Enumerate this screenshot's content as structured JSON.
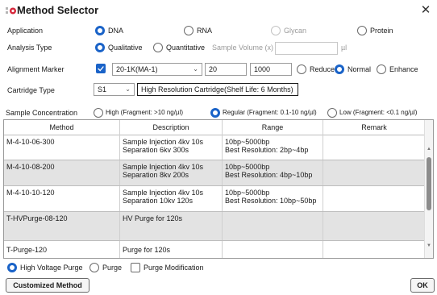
{
  "window": {
    "title": "Method Selector",
    "close_symbol": "✕"
  },
  "application": {
    "label": "Application",
    "options": [
      "DNA",
      "RNA",
      "Glycan",
      "Protein"
    ],
    "selected": "DNA"
  },
  "analysis": {
    "label": "Analysis Type",
    "options": [
      "Qualitative",
      "Quantitative"
    ],
    "selected": "Qualitative",
    "volume_label": "Sample Volume (x) :",
    "volume_value": "",
    "volume_unit": "µl"
  },
  "alignment": {
    "label": "Alignment Marker",
    "checked": true,
    "marker_value": "20-1K(MA-1)",
    "low_value": "20",
    "high_value": "1000",
    "modes": [
      "Reduce",
      "Normal",
      "Enhance"
    ],
    "selected_mode": "Normal"
  },
  "cartridge": {
    "label": "Cartridge Type",
    "type_value": "S1",
    "description": "High Resolution Cartridge(Shelf Life: 6 Months)"
  },
  "concentration": {
    "label": "Sample Concentration",
    "options": [
      "High (Fragment: >10 ng/µl)",
      "Regular (Fragment: 0.1-10 ng/µl)",
      "Low (Fragment: <0.1 ng/µl)"
    ],
    "selected": "Regular (Fragment: 0.1-10 ng/µl)"
  },
  "table": {
    "columns": [
      "Method",
      "Description",
      "Range",
      "Remark"
    ],
    "rows": [
      {
        "method": "M-4-10-06-300",
        "desc1": "Sample Injection 4kv 10s",
        "desc2": "Separation 6kv 300s",
        "range1": "10bp~5000bp",
        "range2": "Best Resolution: 2bp~4bp",
        "remark": ""
      },
      {
        "method": "M-4-10-08-200",
        "desc1": "Sample Injection 4kv 10s",
        "desc2": "Separation 8kv 200s",
        "range1": "10bp~5000bp",
        "range2": "Best Resolution: 4bp~10bp",
        "remark": ""
      },
      {
        "method": "M-4-10-10-120",
        "desc1": "Sample Injection 4kv 10s",
        "desc2": "Separation 10kv 120s",
        "range1": "10bp~5000bp",
        "range2": "Best Resolution: 10bp~50bp",
        "remark": ""
      },
      {
        "method": "T-HVPurge-08-120",
        "desc1": "HV Purge for 120s",
        "desc2": "",
        "range1": "",
        "range2": "",
        "remark": ""
      },
      {
        "method": "T-Purge-120",
        "desc1": "Purge for 120s",
        "desc2": "",
        "range1": "",
        "range2": "",
        "remark": ""
      }
    ],
    "scroll_position": 0.35
  },
  "purge": {
    "options": [
      "High Voltage Purge",
      "Purge"
    ],
    "selected": "High Voltage Purge",
    "modification_label": "Purge Modification",
    "modification_checked": false
  },
  "buttons": {
    "customized": "Customized Method",
    "ok": "OK"
  },
  "colors": {
    "accent": "#1a63c8",
    "row_shade": "#e3e3e3"
  }
}
